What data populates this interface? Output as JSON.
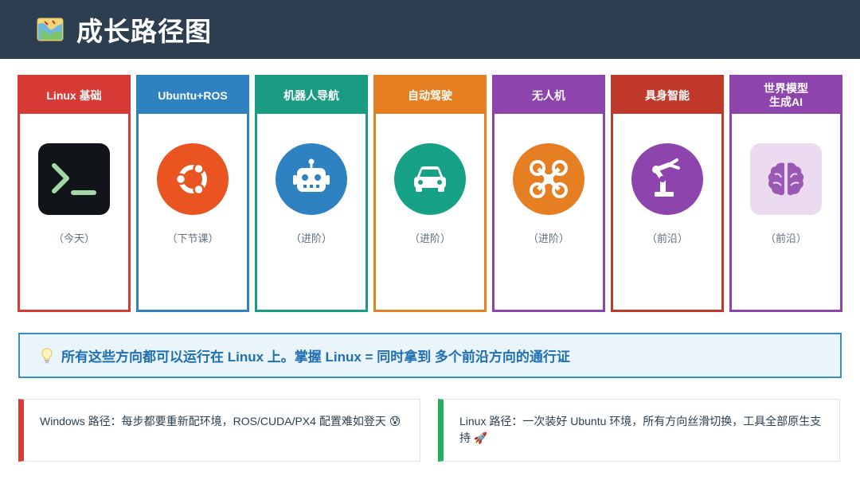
{
  "header": {
    "title": "成长路径图",
    "icon": "map-icon"
  },
  "cards": [
    {
      "title": "Linux 基础",
      "subtitle": "（今天）",
      "color": "#d83b35",
      "icon": "terminal-icon"
    },
    {
      "title": "Ubuntu+ROS",
      "subtitle": "（下节课）",
      "color": "#2f82c2",
      "icon": "ubuntu-icon"
    },
    {
      "title": "机器人导航",
      "subtitle": "（进阶）",
      "color": "#1a9c82",
      "icon": "robot-icon"
    },
    {
      "title": "自动驾驶",
      "subtitle": "（进阶）",
      "color": "#e67e22",
      "icon": "car-icon"
    },
    {
      "title": "无人机",
      "subtitle": "（进阶）",
      "color": "#8e44ad",
      "icon": "drone-icon"
    },
    {
      "title": "具身智能",
      "subtitle": "（前沿）",
      "color": "#c0392b",
      "icon": "robot-arm-icon"
    },
    {
      "title": "世界模型\n生成AI",
      "subtitle": "（前沿）",
      "color": "#8e44ad",
      "icon": "brain-icon"
    }
  ],
  "tip": {
    "text": "所有这些方向都可以运行在 Linux 上。掌握 Linux = 同时拿到 多个前沿方向的通行证",
    "icon": "lightbulb-icon"
  },
  "notes": [
    {
      "text": "Windows 路径：每步都要重新配环境，ROS/CUDA/PX4 配置难如登天 😰",
      "color": "#d83b35"
    },
    {
      "text": "Linux 路径：一次装好 Ubuntu 环境，所有方向丝滑切换，工具全部原生支持 🚀",
      "color": "#27ae60"
    }
  ]
}
